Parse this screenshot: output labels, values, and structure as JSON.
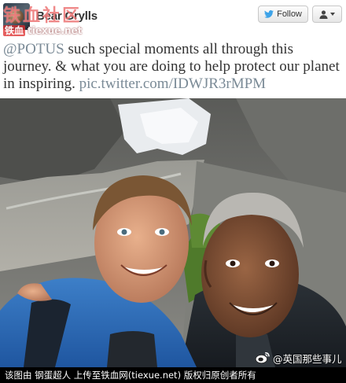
{
  "tweet": {
    "display_name": "Bear Grylls",
    "follow_label": "Follow",
    "text_mention": "@POTUS",
    "text_body": " such special moments all through this journey. & what you are doing to help protect our planet in inspiring. ",
    "text_link": "pic.twitter.com/IDWJR3rMPM"
  },
  "watermarks": {
    "site_logo": "铁血社区",
    "site_url_prefix": "铁血",
    "site_url": "tiexue.net",
    "weibo_account": "@英国那些事儿",
    "bottom_notice": "该图由 钢蛋超人 上传至铁血网(tiexue.net) 版权归原创者所有"
  },
  "colors": {
    "link_gray": "#7a8a96",
    "text": "#333333",
    "watermark_red": "#e02828"
  },
  "icons": [
    "twitter-bird-icon",
    "person-icon",
    "caret-down-icon",
    "weibo-icon"
  ]
}
